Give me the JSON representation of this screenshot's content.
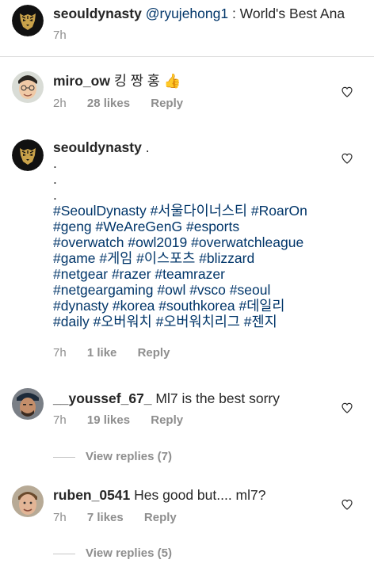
{
  "comments": [
    {
      "username": "seouldynasty",
      "mention": "@ryujehong1",
      "text": " : World's Best Ana",
      "time": "7h"
    },
    {
      "username": "miro_ow",
      "text": " 킹 짱 홍 👍",
      "time": "2h",
      "likes": "28 likes",
      "reply": "Reply"
    },
    {
      "username": "seouldynasty",
      "text": " .",
      "dots": [
        ".",
        ".",
        "."
      ],
      "hashtag_lines": [
        "#SeoulDynasty #서울다이너스티 #RoarOn",
        "#geng #WeAreGenG #esports",
        "#overwatch #owl2019 #overwatchleague",
        "#game #게임 #이스포츠 #blizzard",
        "#netgear #razer #teamrazer",
        "#netgeargaming #owl #vsco #seoul",
        "#dynasty #korea #southkorea #데일리",
        "#daily #오버워치 #오버워치리그 #젠지"
      ],
      "time": "7h",
      "likes": "1 like",
      "reply": "Reply"
    },
    {
      "username": "__youssef_67_",
      "text": " Ml7 is the best sorry",
      "time": "7h",
      "likes": "19 likes",
      "reply": "Reply",
      "view_replies": "View replies (7)"
    },
    {
      "username": "ruben_0541",
      "text": " Hes good but.... ml7?",
      "time": "7h",
      "likes": "7 likes",
      "reply": "Reply",
      "view_replies": "View replies (5)"
    }
  ],
  "colors": {
    "text": "#262626",
    "meta": "#8e8e8e",
    "link": "#003569",
    "divider": "#dbdbdb"
  }
}
